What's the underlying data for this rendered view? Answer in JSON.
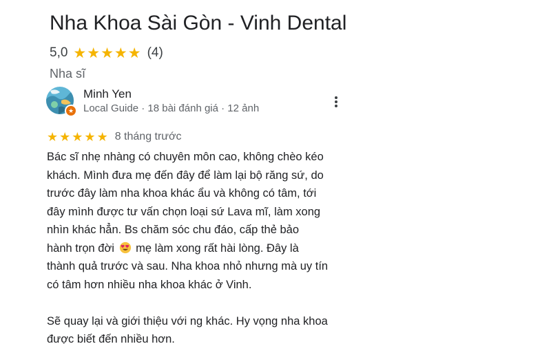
{
  "place": {
    "title": "Nha Khoa Sài Gòn - Vinh Dental",
    "rating": "5,0",
    "review_count": "(4)",
    "category": "Nha sĩ",
    "stars": 5
  },
  "review": {
    "author": "Minh Yen",
    "author_meta": "Local Guide · 18 bài đánh giá · 12 ảnh",
    "stars": 5,
    "time": "8 tháng trước",
    "lines": [
      "Bác sĩ nhẹ nhàng có chuyên môn cao, không chèo kéo",
      "khách. Mình đưa mẹ đến đây để làm lại bộ răng sứ, do",
      "trước đây làm nha khoa khác ẩu và không có tâm, tới",
      "đây mình được tư vấn chọn loại sứ Lava mĩ, làm xong",
      "nhìn khác hẳn. Bs chăm sóc chu đáo, cấp thẻ bảo",
      "hành trọn đời",
      "mẹ làm xong rất hài lòng. Đây là",
      "thành quả trước và sau. Nha khoa nhỏ nhưng mà uy tín",
      "có tâm hơn nhiều nha khoa khác ở Vinh.",
      "Sẽ quay lại và giới thiệu với ng khác. Hy vọng nha khoa",
      "được biết đến nhiều hơn."
    ]
  },
  "icons": {
    "star": "star-icon",
    "more": "more-vert-icon",
    "emoji": "heart-eyes-emoji",
    "badge": "local-guide-badge-icon"
  },
  "colors": {
    "star": "#f5b400",
    "badge": "#e8710a",
    "text": "#202124",
    "secondary": "#5f6368"
  }
}
